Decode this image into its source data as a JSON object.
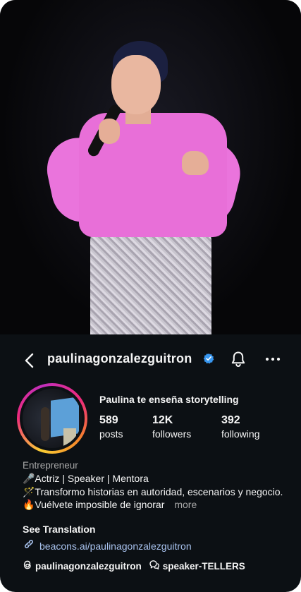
{
  "header": {
    "username": "paulinagonzalezguitron"
  },
  "profile": {
    "display_name": "Paulina te enseña storytelling",
    "stats": [
      {
        "value": "589",
        "label": "posts"
      },
      {
        "value": "12K",
        "label": "followers"
      },
      {
        "value": "392",
        "label": "following"
      }
    ],
    "category": "Entrepreneur",
    "bio": [
      "🎤Actriz | Speaker | Mentora",
      "🪄Transformo historias en autoridad, escenarios y negocio.",
      "🔥Vuélvete imposible de ignorar"
    ],
    "more_label": "more",
    "see_translation": "See Translation",
    "link": "beacons.ai/paulinagonzalezguitron",
    "threads_handle": "paulinagonzalezguitron",
    "channel_name": "speaker-TELLERS"
  },
  "icons": {
    "back": "chevron-left-icon",
    "verified": "verified-badge-icon",
    "notifications": "bell-icon",
    "more": "ellipsis-icon",
    "link": "link-icon",
    "threads": "threads-icon",
    "channel": "broadcast-channel-icon"
  },
  "colors": {
    "background": "#0c1014",
    "verified": "#3897f0",
    "link": "#a9c3ef",
    "muted": "#a8a8a8"
  }
}
